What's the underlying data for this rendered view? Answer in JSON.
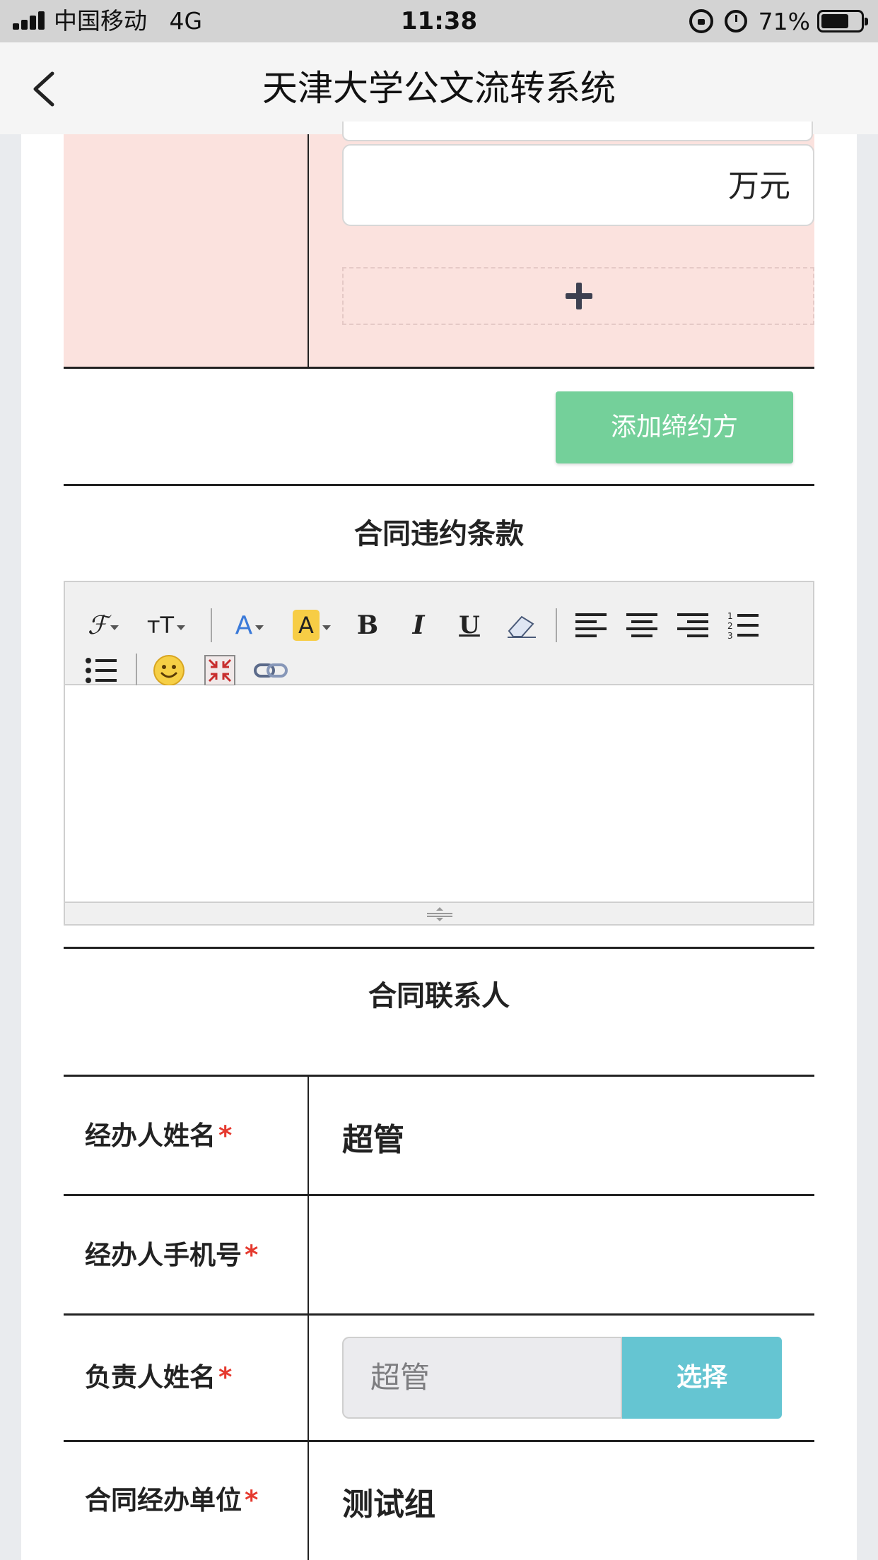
{
  "status_bar": {
    "carrier": "中国移动",
    "network": "4G",
    "time": "11:38",
    "battery_percent": "71%",
    "battery_level": 0.71
  },
  "nav": {
    "title": "天津大学公文流转系统",
    "back_icon": "chevron-left-icon"
  },
  "party_block": {
    "amount_unit": "万元",
    "add_row_icon": "plus-icon",
    "add_party_label": "添加缔约方"
  },
  "breach_section": {
    "title": "合同违约条款",
    "toolbar_icons": [
      "font-family-icon",
      "font-size-icon",
      "font-color-icon",
      "highlight-color-icon",
      "bold-icon",
      "italic-icon",
      "underline-icon",
      "eraser-icon",
      "align-left-icon",
      "align-center-icon",
      "align-right-icon",
      "ordered-list-icon",
      "unordered-list-icon",
      "emoji-icon",
      "fullscreen-icon",
      "link-icon"
    ],
    "bold_glyph": "B",
    "italic_glyph": "I",
    "underline_glyph": "U",
    "font_color_glyph": "A",
    "highlight_glyph": "A",
    "font_size_glyph": "тT",
    "font_family_glyph": "ℱ"
  },
  "contacts_section": {
    "title": "合同联系人",
    "rows": [
      {
        "label": "经办人姓名",
        "required": "*",
        "value": "超管"
      },
      {
        "label": "经办人手机号",
        "required": "*",
        "value": ""
      },
      {
        "label": "负责人姓名",
        "required": "*",
        "input_value": "超管",
        "button_label": "选择"
      },
      {
        "label": "合同经办单位",
        "required": "*",
        "value": "测试组"
      }
    ]
  },
  "colors": {
    "pink_background": "#fbe2de",
    "add_party_button": "#74d09a",
    "select_button": "#65c5d2",
    "required_star": "#e53a2f"
  }
}
